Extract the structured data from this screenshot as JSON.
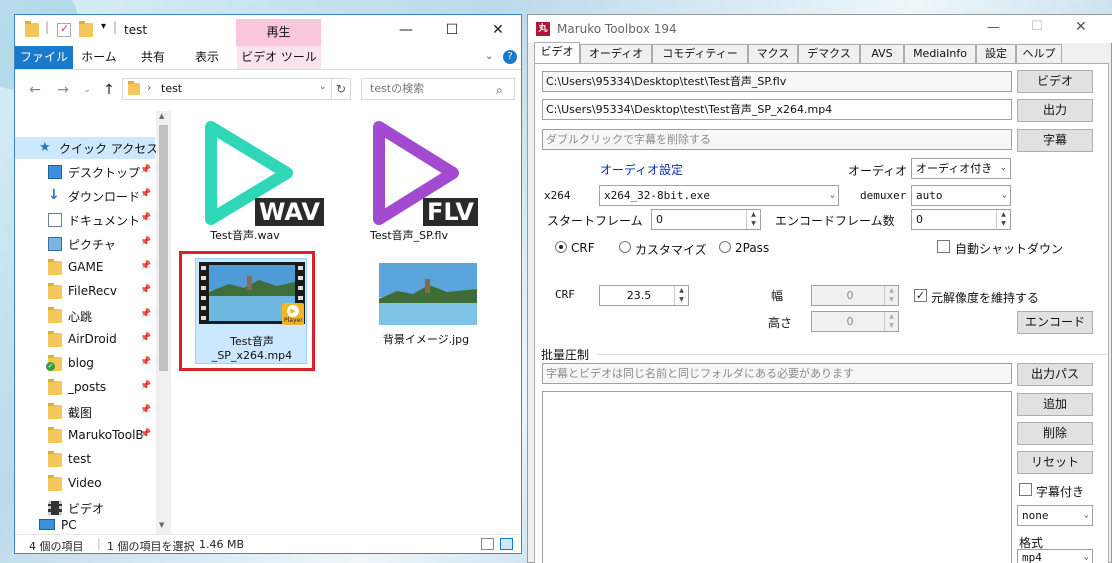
{
  "explorer": {
    "title": "test",
    "tabs": {
      "file": "ファイル",
      "home": "ホーム",
      "share": "共有",
      "view": "表示",
      "video_tools": "ビデオ ツール",
      "play": "再生"
    },
    "address": "test",
    "search_placeholder": "testの検索",
    "nav": {
      "quick_access": "クイック アクセス",
      "items": [
        "デスクトップ",
        "ダウンロード",
        "ドキュメント",
        "ピクチャ",
        "GAME",
        "FileRecv",
        "心跳",
        "AirDroid",
        "blog",
        "_posts",
        "截图",
        "MarukoToolB",
        "test",
        "Video",
        "ビデオ"
      ],
      "pc": "PC"
    },
    "files": [
      {
        "name": "Test音声.wav",
        "badge": "WAV"
      },
      {
        "name": "Test音声_SP.flv",
        "badge": "FLV"
      },
      {
        "name_line1": "Test音声",
        "name_line2": "_SP_x264.mp4",
        "overlay": "Player"
      },
      {
        "name": "背景イメージ.jpg"
      }
    ],
    "status": {
      "count": "4 個の項目",
      "selected": "1 個の項目を選択",
      "size": "1.46 MB"
    }
  },
  "maruko": {
    "title": "Maruko Toolbox 194",
    "tabs": [
      "ビデオ",
      "オーディオ",
      "コモディティー",
      "マクス",
      "デマクス",
      "AVS",
      "MediaInfo",
      "設定",
      "ヘルプ"
    ],
    "video_path": "C:\\Users\\95334\\Desktop\\test\\Test音声_SP.flv",
    "output_path": "C:\\Users\\95334\\Desktop\\test\\Test音声_SP_x264.mp4",
    "subtitle_placeholder": "ダブルクリックで字幕を削除する",
    "buttons": {
      "video": "ビデオ",
      "output": "出力",
      "subtitle": "字幕",
      "encode": "エンコード",
      "output_path": "出力パス",
      "add": "追加",
      "delete": "削除",
      "reset": "リセット"
    },
    "audio_settings": "オーディオ設定",
    "audio_label": "オーディオ",
    "audio_combo": "オーディオ付き",
    "x264_label": "x264",
    "x264_combo": "x264_32-8bit.exe",
    "demuxer_label": "demuxer",
    "demuxer_combo": "auto",
    "start_frame_label": "スタートフレーム",
    "start_frame": "0",
    "encode_frames_label": "エンコードフレーム数",
    "encode_frames": "0",
    "modes": [
      "CRF",
      "カスタマイズ",
      "2Pass"
    ],
    "auto_shutdown": "自動シャットダウン",
    "crf_label": "CRF",
    "crf_value": "23.5",
    "width_label": "幅",
    "width_value": "0",
    "height_label": "高さ",
    "height_value": "0",
    "keep_resolution": "元解像度を維持する",
    "batch_label": "批量圧制",
    "batch_placeholder": "字幕とビデオは同じ名前と同じフォルダにある必要があります",
    "with_subtitle": "字幕付き",
    "sub_combo": "none",
    "format_label": "格式",
    "format_combo": "mp4"
  }
}
